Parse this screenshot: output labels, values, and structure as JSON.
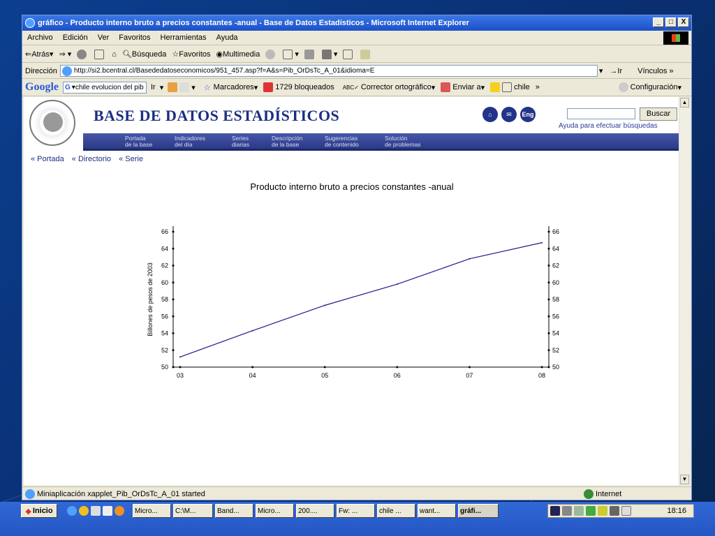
{
  "window": {
    "title": "gráfico - Producto interno bruto a precios constantes -anual - Base de Datos Estadísticos - Microsoft Internet Explorer",
    "minimize": "_",
    "maximize": "□",
    "close": "X"
  },
  "menu": [
    "Archivo",
    "Edición",
    "Ver",
    "Favoritos",
    "Herramientas",
    "Ayuda"
  ],
  "toolbar": {
    "back": "Atrás",
    "search": "Búsqueda",
    "favorites": "Favoritos",
    "multimedia": "Multimedia"
  },
  "address": {
    "label": "Dirección",
    "url": "http://si2.bcentral.cl/Basededatoseconomicos/951_457.asp?f=A&s=Pib_OrDsTc_A_01&idioma=E",
    "go": "Ir",
    "links": "Vínculos"
  },
  "google_bar": {
    "logo": "Google",
    "query": "chile evolucion del pib",
    "go": "Ir",
    "bookmarks": "Marcadores",
    "blocked": "1729 bloqueados",
    "spellcheck": "Corrector ortográfico",
    "send": "Enviar a",
    "chile": "chile",
    "config": "Configuración"
  },
  "site": {
    "banner": "BASE DE DATOS ESTADÍSTICOS",
    "eng": "Eng",
    "search_button": "Buscar",
    "search_help": "Ayuda para efectuar búsquedas",
    "nav": [
      {
        "l1": "Portada",
        "l2": "de la base"
      },
      {
        "l1": "Indicadores",
        "l2": "del día"
      },
      {
        "l1": "Series",
        "l2": "diarias"
      },
      {
        "l1": "Descripción",
        "l2": "de la base"
      },
      {
        "l1": "Sugerencias",
        "l2": "de contenido"
      },
      {
        "l1": "Solución",
        "l2": "de problemas"
      }
    ],
    "breadcrumbs": [
      "« Portada",
      "« Directorio",
      "« Serie"
    ]
  },
  "chart_data": {
    "type": "line",
    "title": "Producto interno bruto a precios constantes -anual",
    "ylabel": "Billones de pesos de 2003",
    "xlabel": "",
    "categories": [
      "03",
      "04",
      "05",
      "06",
      "07",
      "08"
    ],
    "series": [
      {
        "values": [
          51.2,
          54.3,
          57.3,
          59.8,
          62.8,
          64.7
        ],
        "color": "#1a1a8c"
      }
    ],
    "ylim": [
      50,
      66
    ],
    "yticks": [
      50,
      52,
      54,
      56,
      58,
      60,
      62,
      64,
      66
    ],
    "right_axis": true,
    "grid": false
  },
  "status": {
    "text": "Miniaplicación xapplet_Pib_OrDsTc_A_01 started",
    "zone": "Internet"
  },
  "taskbar": {
    "start": "Inicio",
    "tasks": [
      "Micro...",
      "C:\\M...",
      "Band...",
      "Micro...",
      "200....",
      "Fw: ...",
      "chile ...",
      "want...",
      "gráfi..."
    ],
    "clock": "18:16"
  }
}
